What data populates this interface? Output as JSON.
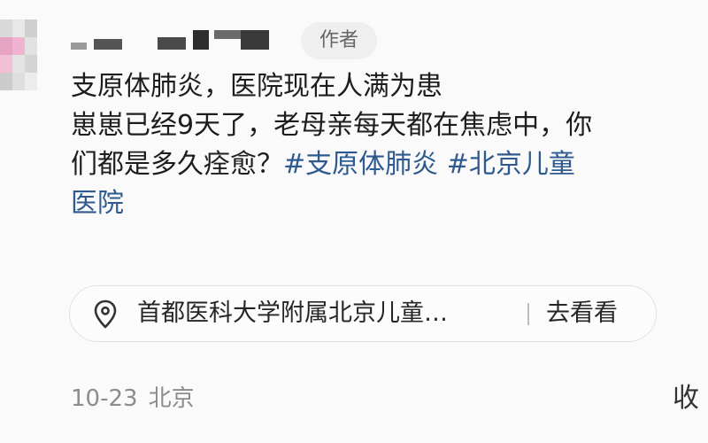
{
  "comment": {
    "author_badge": "作者",
    "lines": [
      [
        {
          "text": "支原体肺炎，医院现在人满为患",
          "hashtag": false
        }
      ],
      [
        {
          "text": "崽崽已经9天了，老母亲每天都在焦虑中，你",
          "hashtag": false
        }
      ],
      [
        {
          "text": "们都是多久痊愈？",
          "hashtag": false
        },
        {
          "text": "#支原体肺炎",
          "hashtag": true
        },
        {
          "text": " ",
          "hashtag": false
        },
        {
          "text": "#北京儿童",
          "hashtag": true
        }
      ],
      [
        {
          "text": "医院",
          "hashtag": true
        }
      ]
    ],
    "location": {
      "icon": "location-pin-icon",
      "name": "首都医科大学附属北京儿童…",
      "action": "去看看"
    },
    "meta": {
      "date": "10-23",
      "region": "北京"
    },
    "collect_label": "收"
  },
  "colors": {
    "hashtag": "#2f5a8f",
    "meta_text": "#8c8c8c",
    "badge_bg": "#efefef",
    "body_text": "#1d1d1d"
  }
}
